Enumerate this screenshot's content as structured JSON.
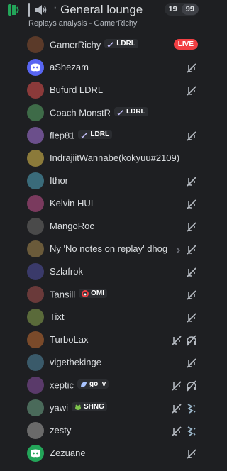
{
  "header": {
    "channel_name": "General lounge",
    "subtitle": "Replays analysis - GamerRichy",
    "count_current": "19",
    "count_limit": "99"
  },
  "users": [
    {
      "name": "GamerRichy",
      "tag": "LDRL",
      "tag_icon": "sword-icon",
      "status": "LIVE",
      "icons": []
    },
    {
      "name": "aShezam",
      "icons": [
        "deafened-icon"
      ],
      "avatar": "discord-default"
    },
    {
      "name": "Bufurd LDRL",
      "icons": [
        "deafened-icon"
      ]
    },
    {
      "name": "Coach MonstR",
      "tag": "LDRL",
      "tag_icon": "sword-icon",
      "icons": []
    },
    {
      "name": "flep81",
      "tag": "LDRL",
      "tag_icon": "sword-icon",
      "icons": [
        "deafened-icon"
      ]
    },
    {
      "name": "IndrajiitWannabe(kokyuu#2109)",
      "icons": []
    },
    {
      "name": "Ithor",
      "icons": [
        "deafened-icon"
      ]
    },
    {
      "name": "Kelvin HUI",
      "icons": [
        "deafened-icon"
      ]
    },
    {
      "name": "MangoRoc",
      "icons": [
        "deafened-icon"
      ]
    },
    {
      "name": "Ny 'No notes on replay' dhog",
      "icons": [
        "deafened-icon"
      ],
      "chevron": true
    },
    {
      "name": "Szlafrok",
      "icons": [
        "deafened-icon"
      ]
    },
    {
      "name": "Tansill",
      "tag": "OMI",
      "tag_icon": "omi-icon",
      "icons": [
        "deafened-icon"
      ]
    },
    {
      "name": "Tixt",
      "icons": [
        "deafened-icon"
      ]
    },
    {
      "name": "TurboLax",
      "icons": [
        "deafened-icon",
        "headphones-off-icon"
      ]
    },
    {
      "name": "vigethekinge",
      "icons": [
        "deafened-icon"
      ]
    },
    {
      "name": "xeptic",
      "tag": "go_v",
      "tag_icon": "leaf-icon",
      "icons": [
        "deafened-icon",
        "headphones-off-icon"
      ]
    },
    {
      "name": "yawi",
      "tag": "SHNG",
      "tag_icon": "frog-icon",
      "icons": [
        "deafened-icon",
        "activity-icon"
      ]
    },
    {
      "name": "zesty",
      "icons": [
        "deafened-icon",
        "activity-icon"
      ]
    },
    {
      "name": "Zezuane",
      "icons": [
        "deafened-icon"
      ],
      "avatar": "discord-default"
    }
  ],
  "colors": {
    "background": "#1e1f22",
    "accent": "#23a559",
    "live": "#f23f43",
    "discord_blurple": "#5865f2",
    "icon_muted": "#b5bac1"
  }
}
